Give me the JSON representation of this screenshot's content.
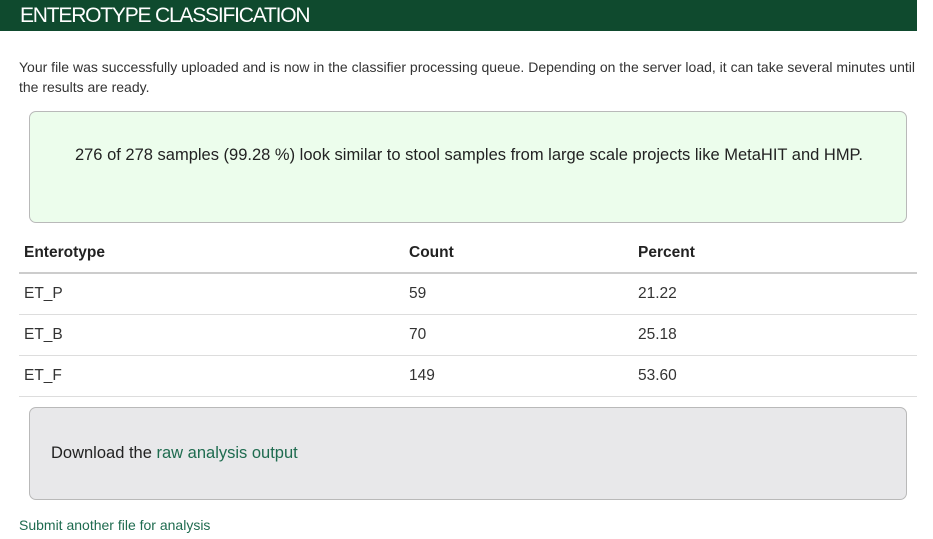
{
  "header": {
    "title": "ENTEROTYPE CLASSIFICATION"
  },
  "intro": {
    "text": "Your file was successfully uploaded and is now in the classifier processing queue. Depending on the server load, it can take several minutes until the results are ready."
  },
  "alert": {
    "text": "276 of 278 samples (99.28 %) look similar to stool samples from large scale projects like MetaHIT and HMP."
  },
  "table": {
    "headers": [
      "Enterotype",
      "Count",
      "Percent"
    ],
    "rows": [
      [
        "ET_P",
        "59",
        "21.22"
      ],
      [
        "ET_B",
        "70",
        "25.18"
      ],
      [
        "ET_F",
        "149",
        "53.60"
      ]
    ]
  },
  "download": {
    "prefix": "Download the",
    "link_label": "raw analysis output"
  },
  "footer": {
    "submit_link": "Submit another file for analysis"
  },
  "colors": {
    "header_bg": "#0f4a2e",
    "alert_bg": "#ecfdec",
    "download_bg": "#e8e8ea",
    "link": "#1e6b4f"
  }
}
